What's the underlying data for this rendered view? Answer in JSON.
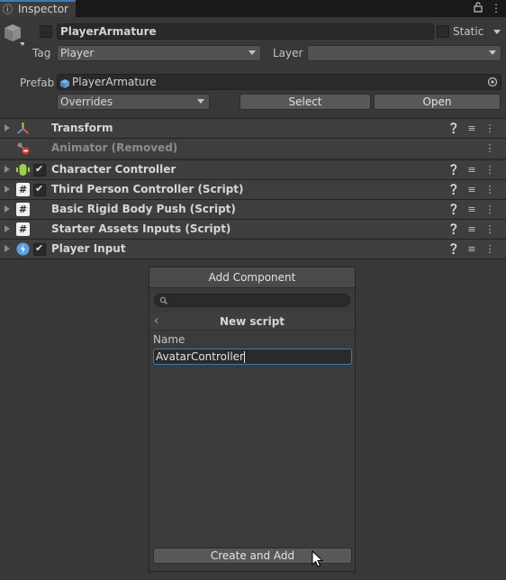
{
  "tab": {
    "label": "Inspector",
    "icon": "info-icon"
  },
  "header": {
    "object_name": "PlayerArmature",
    "static_label": "Static",
    "tag_label": "Tag",
    "tag_value": "Player",
    "layer_label": "Layer",
    "layer_value": "",
    "prefab_label": "Prefab",
    "prefab_value": "PlayerArmature",
    "overrides_label": "Overrides",
    "select_label": "Select",
    "open_label": "Open"
  },
  "components": [
    {
      "name": "Transform",
      "icon": "transform-axes-icon",
      "has_checkbox": false,
      "removed": false
    },
    {
      "name": "Animator (Removed)",
      "icon": "animator-removed-icon",
      "has_checkbox": false,
      "removed": true
    },
    {
      "name": "Character Controller",
      "icon": "character-controller-icon",
      "has_checkbox": true,
      "removed": false
    },
    {
      "name": "Third Person Controller (Script)",
      "icon": "script-hash-icon",
      "has_checkbox": true,
      "removed": false
    },
    {
      "name": "Basic Rigid Body Push (Script)",
      "icon": "script-hash-icon",
      "has_checkbox": false,
      "removed": false
    },
    {
      "name": "Starter Assets Inputs (Script)",
      "icon": "script-hash-icon",
      "has_checkbox": false,
      "removed": false
    },
    {
      "name": "Player Input",
      "icon": "input-system-icon",
      "has_checkbox": true,
      "removed": false
    }
  ],
  "add_component": {
    "title": "Add Component",
    "search_placeholder": "",
    "subtitle": "New script",
    "name_label": "Name",
    "name_value": "AvatarController",
    "create_label": "Create and Add"
  },
  "colors": {
    "accent": "#3a79bb",
    "background": "#383838",
    "removed": "#d23c3c"
  }
}
